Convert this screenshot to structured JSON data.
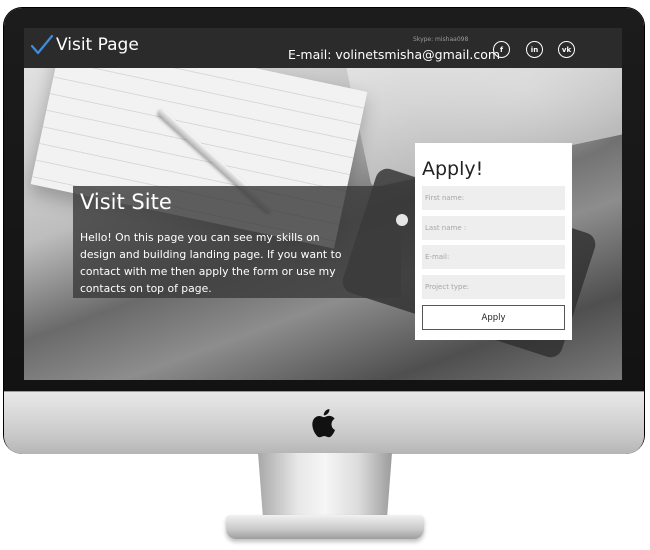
{
  "header": {
    "logo_text": "Visit Page",
    "skype": "Skype: mishaa098",
    "email": "E-mail: volinetsmisha@gmail.com",
    "social": [
      {
        "label": "f",
        "icon": "facebook-icon"
      },
      {
        "label": "in",
        "icon": "linkedin-icon"
      },
      {
        "label": "vk",
        "icon": "vk-icon"
      }
    ]
  },
  "hero": {
    "title": "Visit Site",
    "text": "Hello! On this page you can see my skills on design and building landing page. If you want to contact with me then apply the form or use my contacts on top of page."
  },
  "form": {
    "title": "Apply!",
    "fields": [
      {
        "placeholder": "First name:"
      },
      {
        "placeholder": "Last name :"
      },
      {
        "placeholder": "E-mail:"
      },
      {
        "placeholder": "Project type:"
      }
    ],
    "button": "Apply"
  },
  "colors": {
    "header_bg": "#2b2b2b",
    "accent_check": "#3f8de0",
    "field_bg": "#eeeeee"
  }
}
